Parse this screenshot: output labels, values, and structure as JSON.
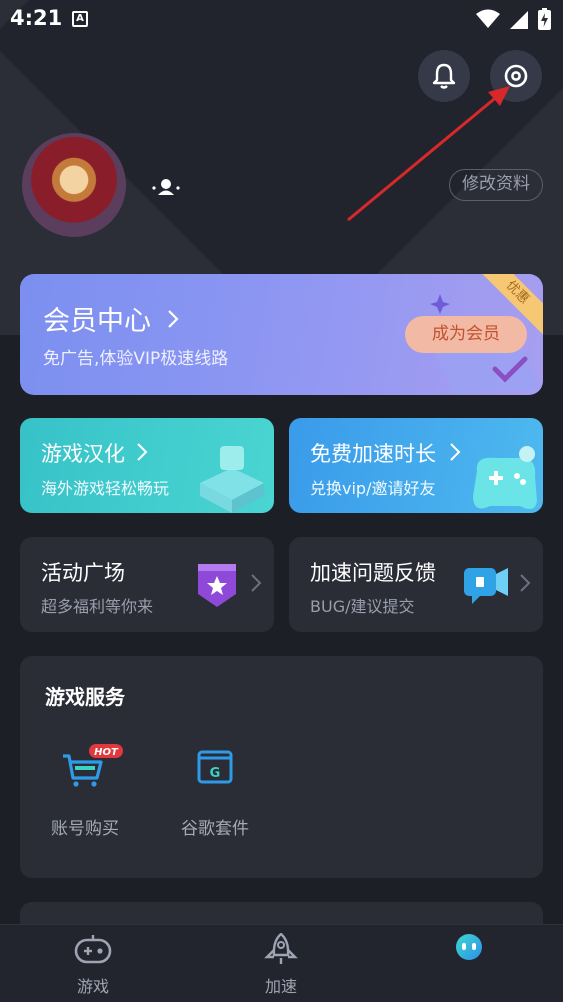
{
  "status_bar": {
    "time": "4:21",
    "notification_icon": "A"
  },
  "header": {
    "bell_icon": "bell-icon",
    "settings_icon": "settings-icon",
    "edit_profile": "修改资料"
  },
  "vip": {
    "title": "会员中心",
    "subtitle": "免广告,体验VIP极速线路",
    "button": "成为会员",
    "ribbon": "优惠",
    "accent": "#8c96f2"
  },
  "tiles": {
    "localization": {
      "title": "游戏汉化",
      "subtitle": "海外游戏轻松畅玩"
    },
    "free_time": {
      "title": "免费加速时长",
      "subtitle": "兑换vip/邀请好友"
    },
    "activity": {
      "title": "活动广场",
      "subtitle": "超多福利等你来"
    },
    "feedback": {
      "title": "加速问题反馈",
      "subtitle": "BUG/建议提交"
    }
  },
  "services": {
    "title": "游戏服务",
    "items": [
      {
        "label": "账号购买",
        "badge": "HOT"
      },
      {
        "label": "谷歌套件",
        "icon_letter": "G"
      }
    ]
  },
  "bottom_nav": {
    "items": [
      {
        "label": "游戏"
      },
      {
        "label": "加速"
      }
    ]
  }
}
